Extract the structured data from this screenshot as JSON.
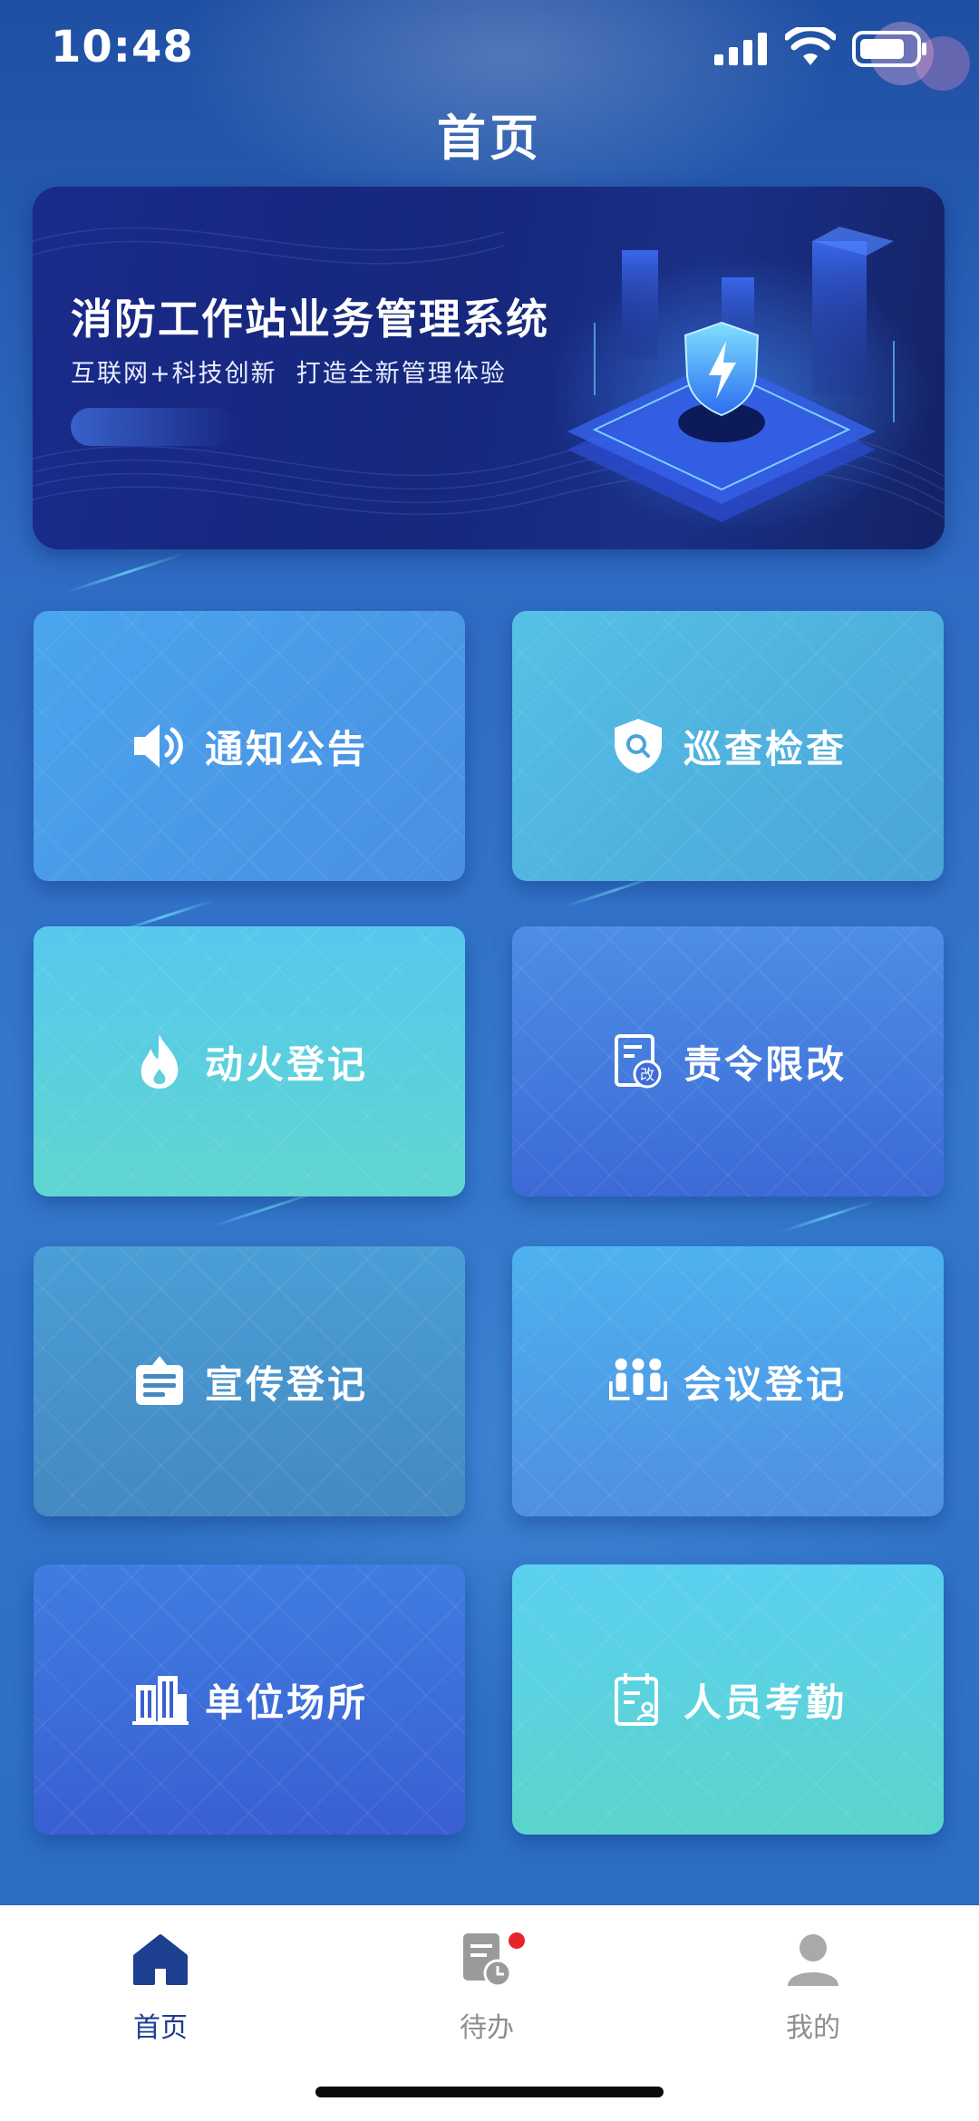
{
  "status_bar": {
    "time": "10:48"
  },
  "page": {
    "title": "首页"
  },
  "banner": {
    "title": "消防工作站业务管理系统",
    "subtitle": "互联网+科技创新  打造全新管理体验"
  },
  "tiles": [
    {
      "label": "通知公告",
      "icon": "speaker-icon"
    },
    {
      "label": "巡查检查",
      "icon": "shield-search-icon"
    },
    {
      "label": "动火登记",
      "icon": "fire-icon"
    },
    {
      "label": "责令限改",
      "icon": "document-correction-icon"
    },
    {
      "label": "宣传登记",
      "icon": "bulletin-board-icon"
    },
    {
      "label": "会议登记",
      "icon": "meeting-people-icon"
    },
    {
      "label": "单位场所",
      "icon": "building-icon"
    },
    {
      "label": "人员考勤",
      "icon": "attendance-icon"
    }
  ],
  "tab_bar": {
    "items": [
      {
        "label": "首页",
        "icon": "home-icon",
        "active": true
      },
      {
        "label": "待办",
        "icon": "todo-document-icon",
        "active": false,
        "badge": true
      },
      {
        "label": "我的",
        "icon": "user-icon",
        "active": false
      }
    ],
    "active_color": "#1d3f8f",
    "inactive_color": "#8d8d8d",
    "badge_color": "#e8232a"
  }
}
